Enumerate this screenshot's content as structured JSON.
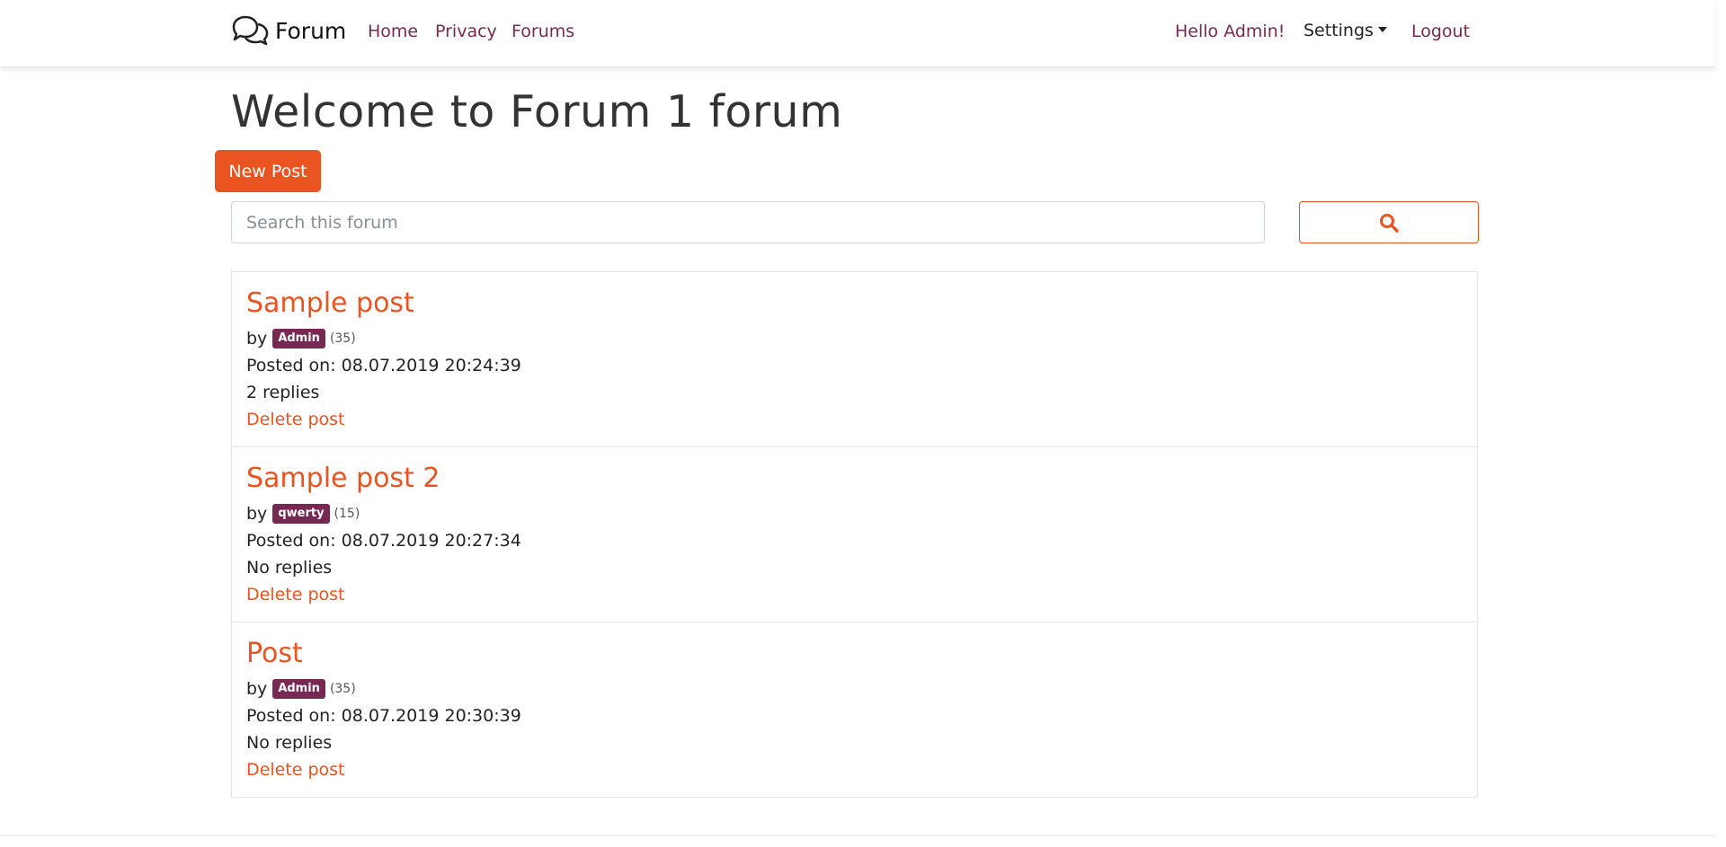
{
  "navbar": {
    "brand": "Forum",
    "brand_icon": "chat-bubbles-icon",
    "links": {
      "home": "Home",
      "privacy": "Privacy",
      "forums": "Forums"
    },
    "greeting": "Hello Admin!",
    "settings": "Settings",
    "logout": "Logout"
  },
  "page": {
    "title": "Welcome to Forum 1 forum",
    "new_post_label": "New Post",
    "search": {
      "placeholder": "Search this forum",
      "value": "",
      "icon": "search-icon"
    }
  },
  "posts": [
    {
      "title": "Sample post",
      "by": "by",
      "author": "Admin",
      "author_rep": "(35)",
      "posted_on": "Posted on: 08.07.2019 20:24:39",
      "replies": "2 replies",
      "delete_label": "Delete post"
    },
    {
      "title": "Sample post 2",
      "by": "by",
      "author": "qwerty",
      "author_rep": "(15)",
      "posted_on": "Posted on: 08.07.2019 20:27:34",
      "replies": "No replies",
      "delete_label": "Delete post"
    },
    {
      "title": "Post",
      "by": "by",
      "author": "Admin",
      "author_rep": "(35)",
      "posted_on": "Posted on: 08.07.2019 20:30:39",
      "replies": "No replies",
      "delete_label": "Delete post"
    }
  ],
  "colors": {
    "accent": "#e95420",
    "secondary": "#772953",
    "text": "#222222"
  }
}
